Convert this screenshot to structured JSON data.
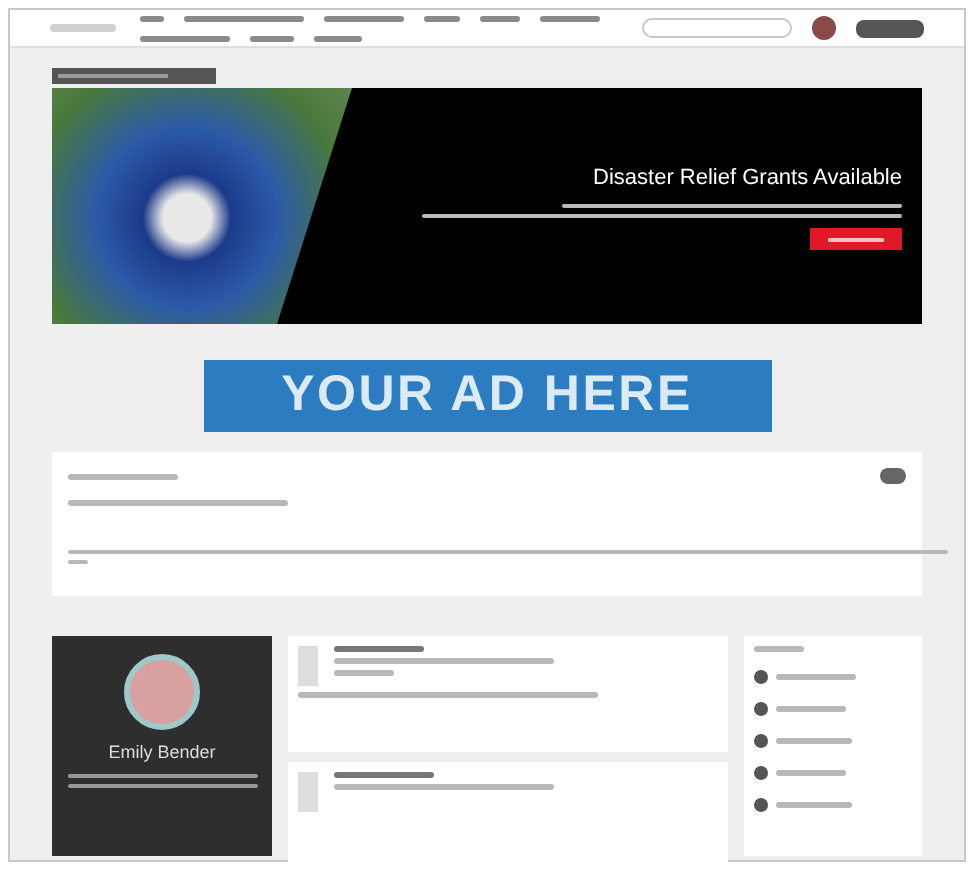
{
  "banner": {
    "title": "Disaster Relief Grants Available"
  },
  "ad": {
    "text": "YOUR AD HERE"
  },
  "profile": {
    "name": "Emily Bender"
  }
}
